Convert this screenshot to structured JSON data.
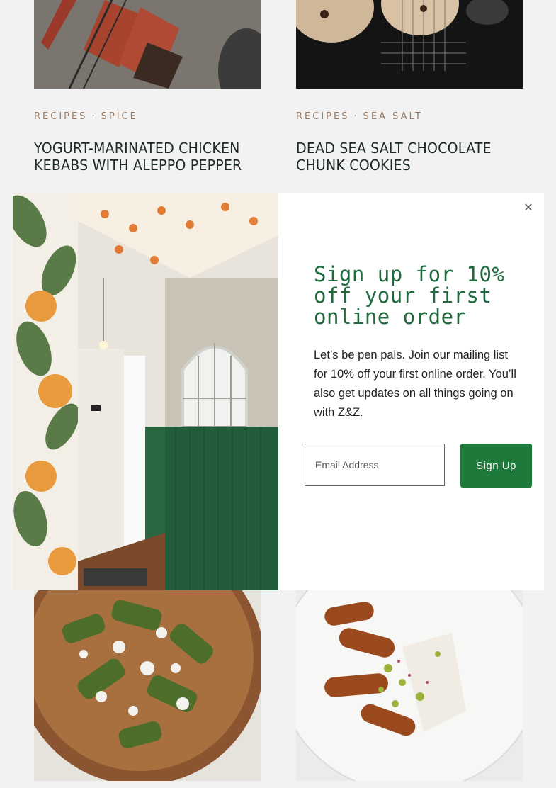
{
  "cards": [
    {
      "tags": [
        "Recipes",
        "Spice"
      ],
      "title": "Yogurt-Marinated Chicken Kebabs with Aleppo Pepper"
    },
    {
      "tags": [
        "Recipes",
        "Sea Salt"
      ],
      "title": "Dead Sea Salt Chocolate Chunk Cookies"
    }
  ],
  "tag_separator": "·",
  "modal": {
    "close_glyph": "✕",
    "headline": "Sign up for 10% off your first online order",
    "description": "Let’s be pen pals. Join our mailing list for 10% off your first online order. You’ll also get updates on all things going on with Z&Z.",
    "email_placeholder": "Email Address",
    "signup_label": "Sign Up"
  },
  "colors": {
    "accent_green": "#1d7a3a",
    "headline_green": "#1f6b3d",
    "tag_brown": "#9a7a63"
  }
}
